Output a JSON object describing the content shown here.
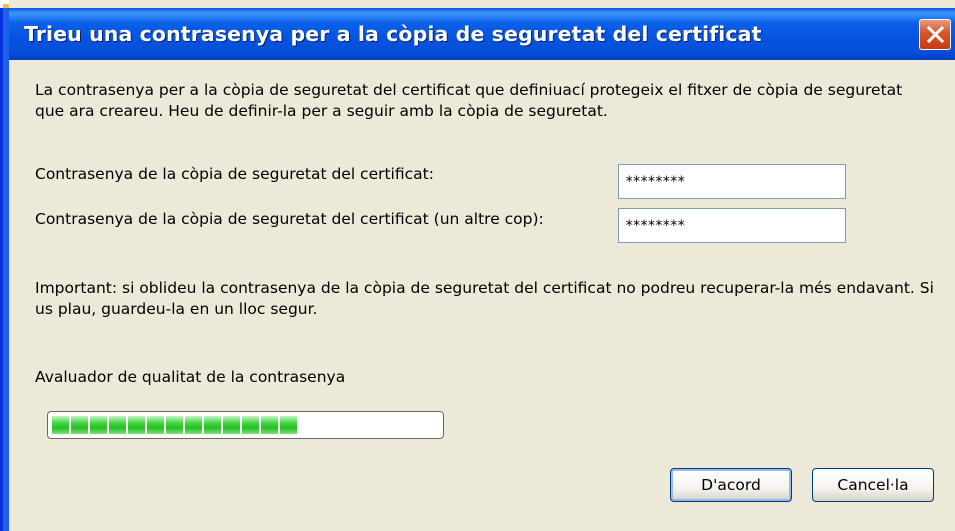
{
  "window": {
    "title": "Trieu una contrasenya per a la còpia de seguretat del certificat"
  },
  "intro_text": "La contrasenya per a la còpia de seguretat del certificat que definiuací protegeix el fitxer de còpia de seguretat que ara creareu. Heu de definir-la per a seguir amb la còpia de seguretat.",
  "password": {
    "label": "Contrasenya de la còpia de seguretat del certificat:",
    "value": "********"
  },
  "confirm_password": {
    "label": "Contrasenya de la còpia de seguretat del certificat (un altre cop):",
    "value": "********"
  },
  "important_text": "Important: si oblideu la contrasenya de la còpia de seguretat del certificat no podreu recuperar-la més endavant. Si us plau, guardeu-la en un lloc segur.",
  "quality_meter": {
    "label": "Avaluador de qualitat de la contrasenya",
    "level": 0.6,
    "color": "#22c022"
  },
  "buttons": {
    "ok_label": "D'acord",
    "cancel_label": "Cancel·la"
  },
  "colors": {
    "titlebar": "#0553df",
    "close_button": "#d9532b",
    "dialog_background": "#ece9d8"
  }
}
